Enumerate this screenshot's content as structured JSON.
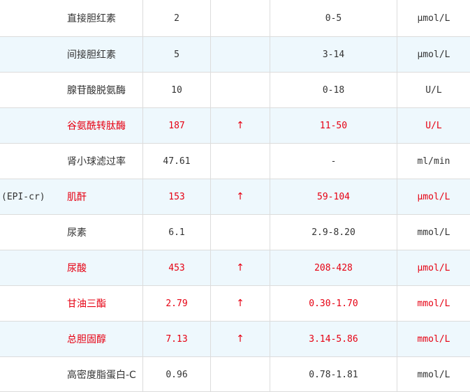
{
  "colors": {
    "abnormal_text": "#e60012",
    "normal_text": "#333333",
    "alt_row_bg": "#eef8fd",
    "grid_line": "#dcdcdc"
  },
  "rows": [
    {
      "code": "",
      "name": "直接胆红素",
      "value": "2",
      "flag": "",
      "range": "0-5",
      "unit": "μmol/L",
      "abnormal": false
    },
    {
      "code": "",
      "name": "间接胆红素",
      "value": "5",
      "flag": "",
      "range": "3-14",
      "unit": "μmol/L",
      "abnormal": false
    },
    {
      "code": "",
      "name": "腺苷酸脱氨酶",
      "value": "10",
      "flag": "",
      "range": "0-18",
      "unit": "U/L",
      "abnormal": false
    },
    {
      "code": "",
      "name": "谷氨酰转肽酶",
      "value": "187",
      "flag": "↑",
      "range": "11-50",
      "unit": "U/L",
      "abnormal": true
    },
    {
      "code": "",
      "name": "肾小球滤过率",
      "value": "47.61",
      "flag": "",
      "range": "-",
      "unit": "ml/min",
      "abnormal": false
    },
    {
      "code": "(EPI-cr)",
      "name": "肌酐",
      "value": "153",
      "flag": "↑",
      "range": "59-104",
      "unit": "μmol/L",
      "abnormal": true
    },
    {
      "code": "",
      "name": "尿素",
      "value": "6.1",
      "flag": "",
      "range": "2.9-8.20",
      "unit": "mmol/L",
      "abnormal": false
    },
    {
      "code": "",
      "name": "尿酸",
      "value": "453",
      "flag": "↑",
      "range": "208-428",
      "unit": "μmol/L",
      "abnormal": true
    },
    {
      "code": "",
      "name": "甘油三酯",
      "value": "2.79",
      "flag": "↑",
      "range": "0.30-1.70",
      "unit": "mmol/L",
      "abnormal": true
    },
    {
      "code": "",
      "name": "总胆固醇",
      "value": "7.13",
      "flag": "↑",
      "range": "3.14-5.86",
      "unit": "mmol/L",
      "abnormal": true
    },
    {
      "code": "",
      "name": "高密度脂蛋白-C",
      "value": "0.96",
      "flag": "",
      "range": "0.78-1.81",
      "unit": "mmol/L",
      "abnormal": false
    }
  ]
}
